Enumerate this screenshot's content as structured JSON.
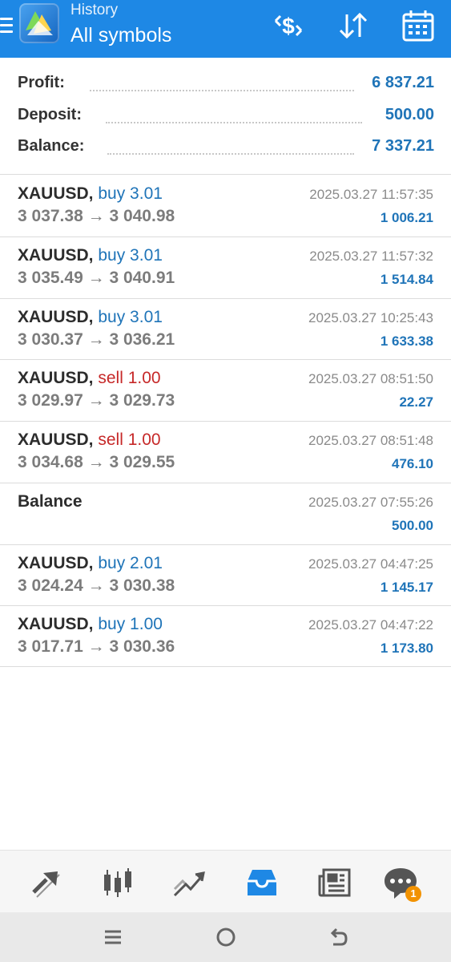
{
  "header": {
    "subtitle": "History",
    "title": "All symbols",
    "icons": [
      "menu-icon",
      "app-logo",
      "deposit-icon",
      "sort-icon",
      "calendar-icon"
    ],
    "bg_color": "#1e88e5"
  },
  "summary": {
    "profit_label": "Profit:",
    "profit_value": "6 837.21",
    "deposit_label": "Deposit:",
    "deposit_value": "500.00",
    "balance_label": "Balance:",
    "balance_value": "7 337.21"
  },
  "deals": [
    {
      "symbol": "XAUUSD,",
      "direction": "buy 3.01",
      "type": "buy",
      "open": "3 037.38",
      "arrow": "→",
      "close": "3 040.98",
      "time": "2025.03.27 11:57:35",
      "profit": "1 006.21"
    },
    {
      "symbol": "XAUUSD,",
      "direction": "buy 3.01",
      "type": "buy",
      "open": "3 035.49",
      "arrow": "→",
      "close": "3 040.91",
      "time": "2025.03.27 11:57:32",
      "profit": "1 514.84"
    },
    {
      "symbol": "XAUUSD,",
      "direction": "buy 3.01",
      "type": "buy",
      "open": "3 030.37",
      "arrow": "→",
      "close": "3 036.21",
      "time": "2025.03.27 10:25:43",
      "profit": "1 633.38"
    },
    {
      "symbol": "XAUUSD,",
      "direction": "sell 1.00",
      "type": "sell",
      "open": "3 029.97",
      "arrow": "→",
      "close": "3 029.73",
      "time": "2025.03.27 08:51:50",
      "profit": "22.27"
    },
    {
      "symbol": "XAUUSD,",
      "direction": "sell 1.00",
      "type": "sell",
      "open": "3 034.68",
      "arrow": "→",
      "close": "3 029.55",
      "time": "2025.03.27 08:51:48",
      "profit": "476.10"
    },
    {
      "symbol": "Balance",
      "direction": "",
      "type": "balance",
      "open": "",
      "arrow": "",
      "close": "",
      "time": "2025.03.27 07:55:26",
      "profit": "500.00"
    },
    {
      "symbol": "XAUUSD,",
      "direction": "buy 2.01",
      "type": "buy",
      "open": "3 024.24",
      "arrow": "→",
      "close": "3 030.38",
      "time": "2025.03.27 04:47:25",
      "profit": "1 145.17"
    },
    {
      "symbol": "XAUUSD,",
      "direction": "buy 1.00",
      "type": "buy",
      "open": "3 017.71",
      "arrow": "→",
      "close": "3 030.36",
      "time": "2025.03.27 04:47:22",
      "profit": "1 173.80"
    }
  ],
  "colors": {
    "buy": "#1f74b8",
    "sell": "#c62828",
    "profit": "#1f74b8",
    "active_tab": "#1e88e5"
  },
  "bottom_nav": {
    "items": [
      "quotes-icon",
      "chart-icon",
      "trade-icon",
      "history-icon",
      "news-icon",
      "chat-icon"
    ],
    "active": "history-icon",
    "chat_badge": "1"
  },
  "system_nav": [
    "recents-icon",
    "home-icon",
    "back-icon"
  ]
}
